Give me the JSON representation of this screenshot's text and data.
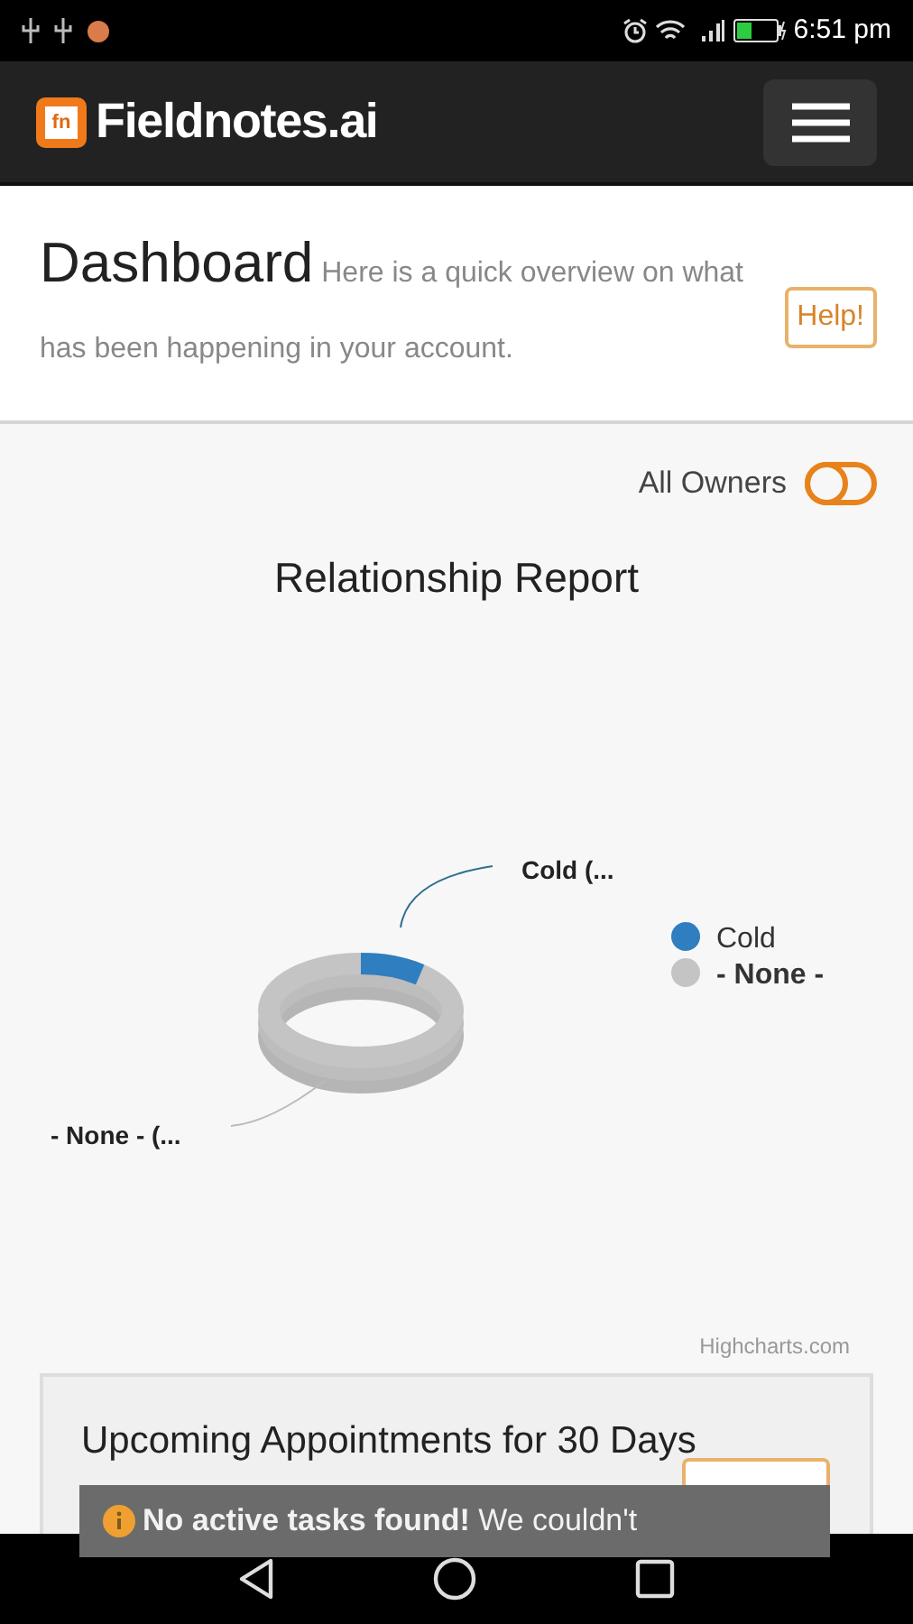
{
  "status_bar": {
    "time": "6:51 pm"
  },
  "navbar": {
    "brand": "Fieldnotes.ai",
    "logo_text": "fn"
  },
  "header": {
    "title": "Dashboard",
    "subtitle": "Here is a quick overview on what has been happening in your account.",
    "help_button": "Help!"
  },
  "owner_filter": {
    "label": "All Owners",
    "on": false
  },
  "report": {
    "title": "Relationship Report",
    "slices": [
      {
        "data_label": "Cold (...",
        "legend": "Cold",
        "color": "#2f7ebf"
      },
      {
        "data_label": "- None - (...",
        "legend": "- None -",
        "color": "#c4c4c4"
      }
    ],
    "credit": "Highcharts.com"
  },
  "appointments": {
    "title": "Upcoming Appointments for 30 Days"
  },
  "toast": {
    "bold": "No active tasks found!",
    "text": "We couldn't"
  }
}
